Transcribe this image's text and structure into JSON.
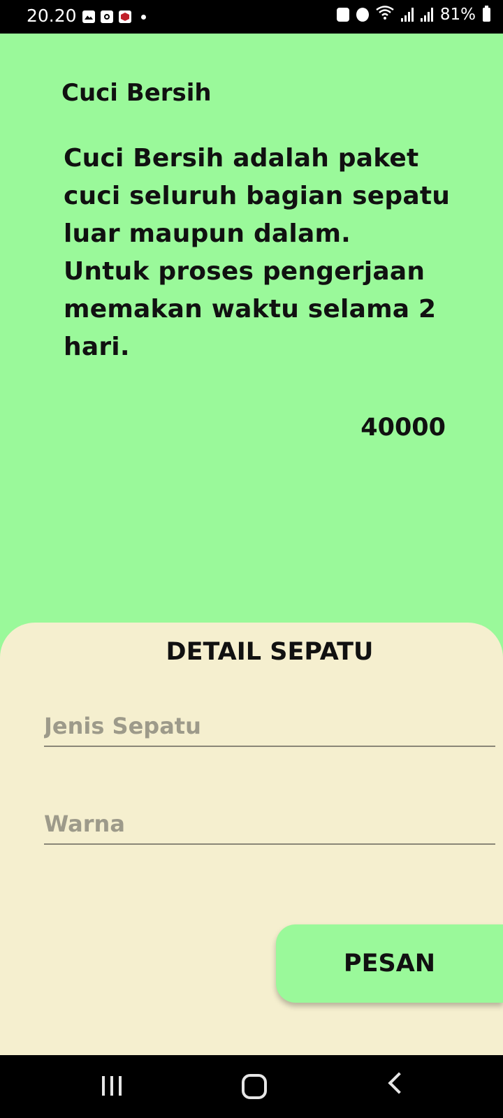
{
  "status_bar": {
    "time": "20.20",
    "battery": "81%",
    "left_icons": [
      "gallery-icon",
      "clock-app-icon",
      "app-icon",
      "notification-dot"
    ],
    "right_icons": [
      "recycle-icon",
      "alarm-icon",
      "wifi-icon",
      "signal-icon",
      "signal-icon",
      "battery-icon"
    ]
  },
  "package": {
    "title": "Cuci Bersih",
    "description": "Cuci Bersih adalah paket\ncuci seluruh bagian sepatu\nluar maupun dalam.\nUntuk proses pengerjaan\nmemakan waktu selama 2\nhari.",
    "price": "40000"
  },
  "detail": {
    "heading": "DETAIL SEPATU",
    "shoe_type_placeholder": "Jenis Sepatu",
    "color_placeholder": "Warna",
    "order_button": "PESAN"
  },
  "colors": {
    "background": "#9af99a",
    "sheet": "#f5efcf",
    "button": "#9af99a"
  },
  "nav_bar": [
    "recents-icon",
    "home-icon",
    "back-icon"
  ]
}
